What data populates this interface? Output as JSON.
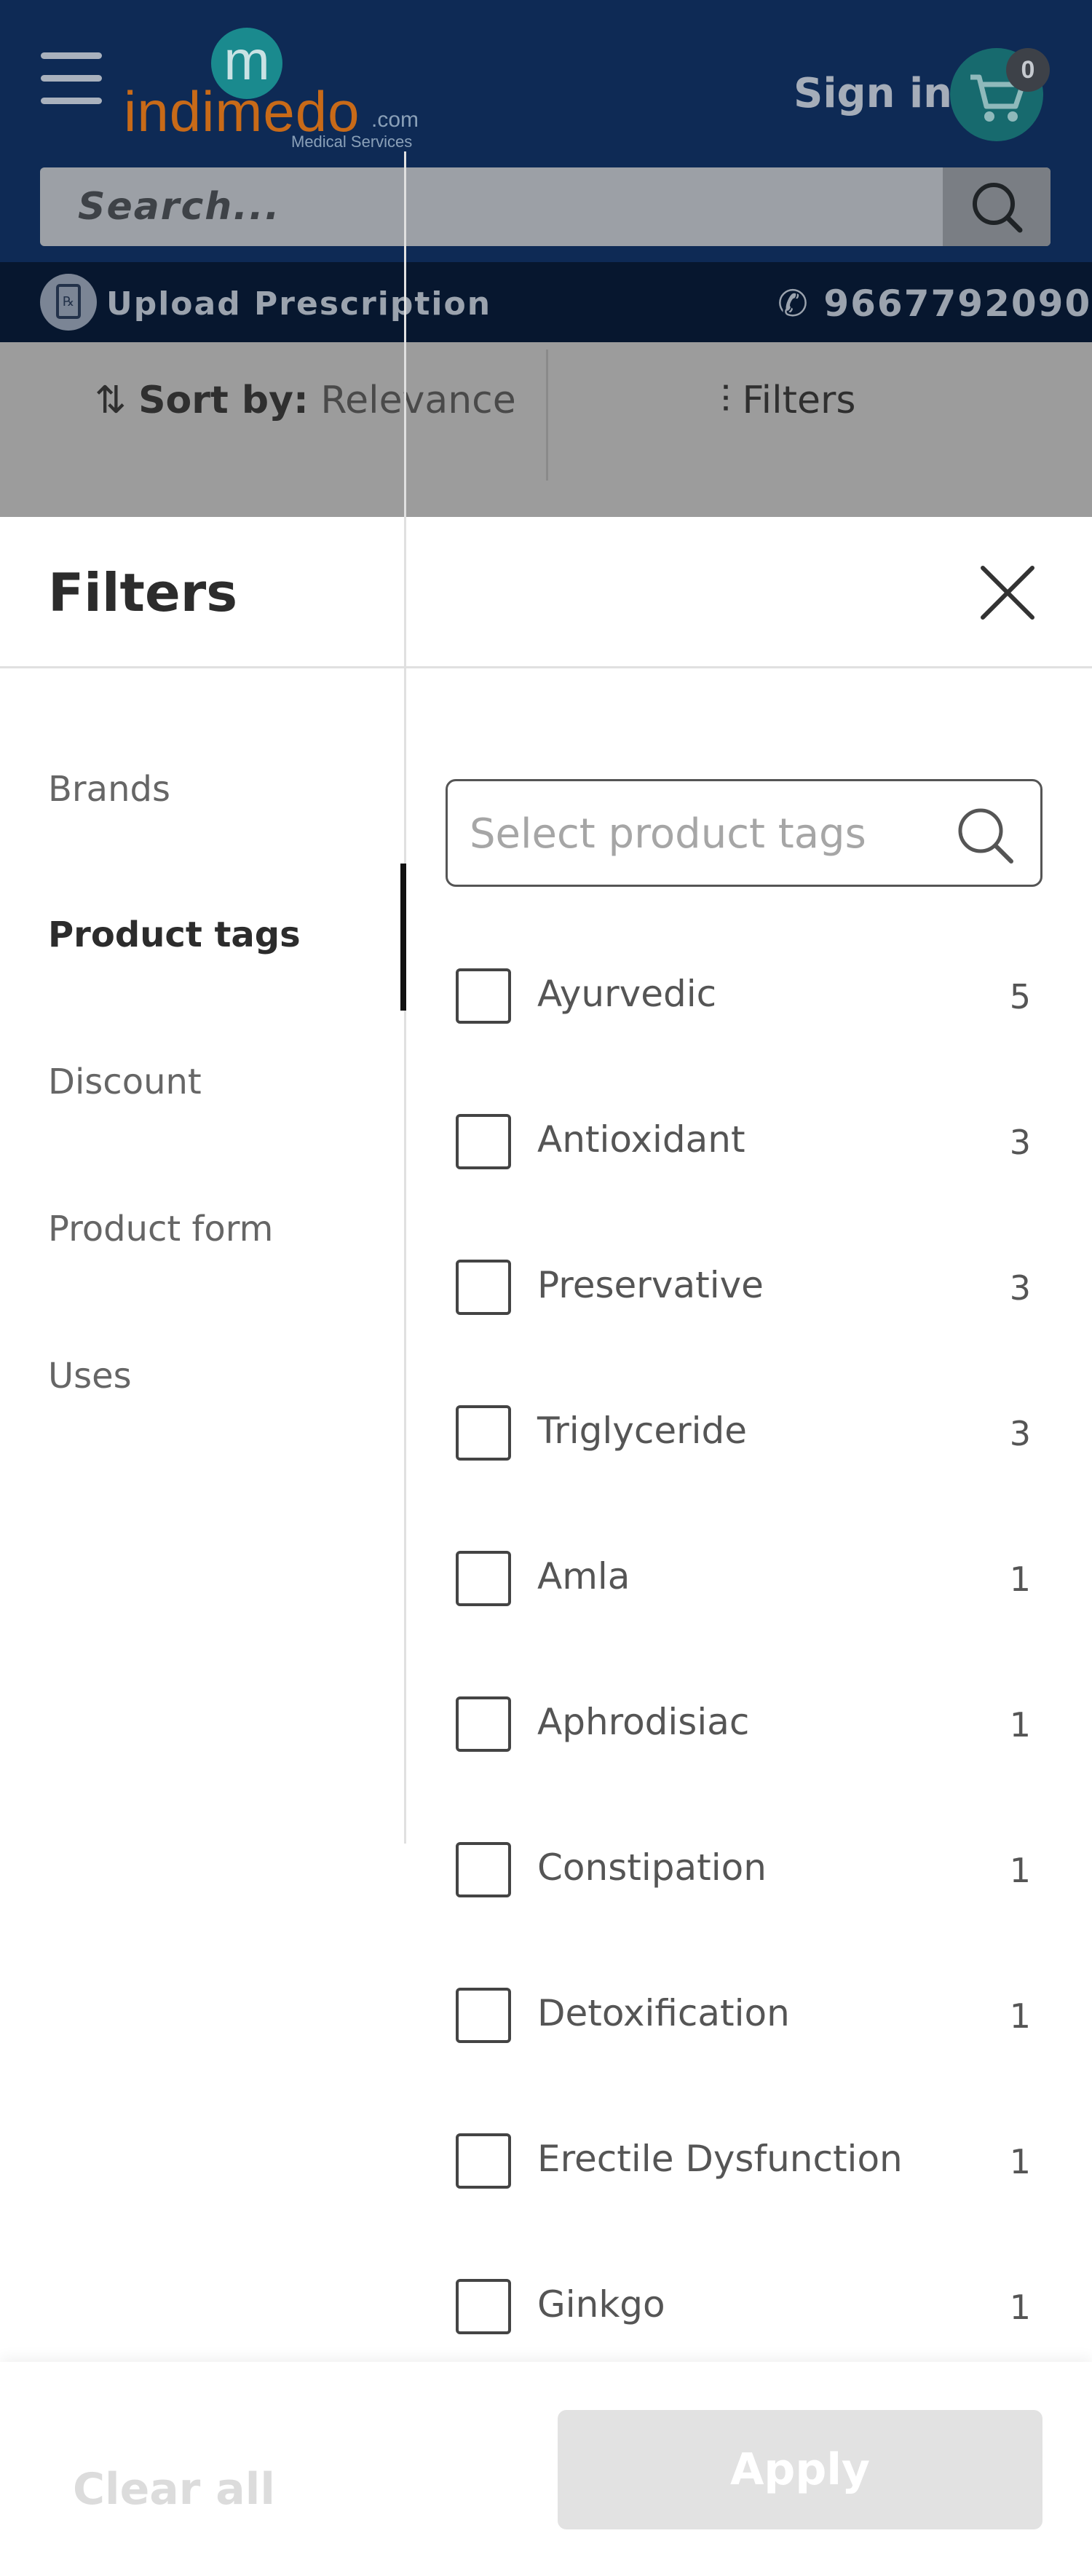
{
  "header": {
    "logo_text": "indimedo",
    "logo_mark": "m",
    "logo_tld": ".com",
    "logo_tagline": "Medical Services",
    "sign_in_label": "Sign in",
    "cart_count": "0",
    "search_placeholder": "Search..."
  },
  "subbar": {
    "upload_label": "Upload Prescription",
    "phone_number": "9667792090"
  },
  "sortbar": {
    "sort_label": "Sort by:",
    "sort_value": "Relevance",
    "filters_label": "Filters"
  },
  "filters": {
    "title": "Filters",
    "categories": [
      {
        "label": "Brands",
        "active": false
      },
      {
        "label": "Product tags",
        "active": true
      },
      {
        "label": "Discount",
        "active": false
      },
      {
        "label": "Product form",
        "active": false
      },
      {
        "label": "Uses",
        "active": false
      }
    ],
    "tag_search_placeholder": "Select product tags",
    "tags": [
      {
        "label": "Ayurvedic",
        "count": "5",
        "checked": false
      },
      {
        "label": "Antioxidant",
        "count": "3",
        "checked": false
      },
      {
        "label": "Preservative",
        "count": "3",
        "checked": false
      },
      {
        "label": "Triglyceride",
        "count": "3",
        "checked": false
      },
      {
        "label": "Amla",
        "count": "1",
        "checked": false
      },
      {
        "label": "Aphrodisiac",
        "count": "1",
        "checked": false
      },
      {
        "label": "Constipation",
        "count": "1",
        "checked": false
      },
      {
        "label": "Detoxification",
        "count": "1",
        "checked": false
      },
      {
        "label": "Erectile Dysfunction",
        "count": "1",
        "checked": false
      },
      {
        "label": "Ginkgo",
        "count": "1",
        "checked": false
      }
    ]
  },
  "footer": {
    "clear_label": "Clear all",
    "apply_label": "Apply"
  },
  "colors": {
    "header_bg": "#0e2a55",
    "accent_orange": "#c86a18",
    "accent_teal": "#1a8a8e",
    "active_indicator": "#111111"
  }
}
